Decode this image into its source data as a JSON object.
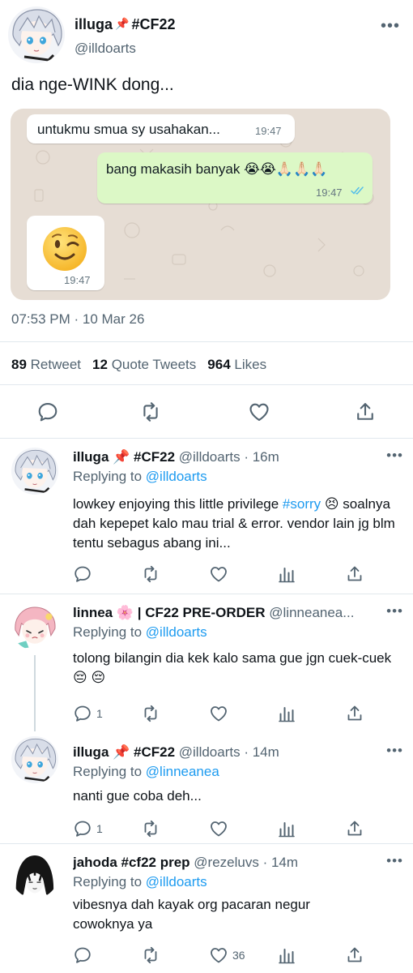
{
  "main_tweet": {
    "author": {
      "name": "illuga",
      "tag": "#CF22",
      "handle": "@illdoarts"
    },
    "text": "dia nge-WINK dong...",
    "chat": {
      "received_1": {
        "text": "untukmu smua sy usahakan...",
        "time": "19:47"
      },
      "sent_1": {
        "text": "bang makasih banyak 😭😭🙏🏻🙏🏻🙏🏻",
        "time": "19:47"
      },
      "received_2": {
        "emoji": "winking-face",
        "time": "19:47"
      }
    },
    "timestamp": "07:53 PM · 10 Mar 26",
    "stats": {
      "retweets": "89",
      "retweets_label": "Retweet",
      "quotes": "12",
      "quotes_label": "Quote Tweets",
      "likes": "964",
      "likes_label": "Likes"
    },
    "actions": [
      "reply-icon",
      "retweet-icon",
      "like-icon",
      "share-icon"
    ]
  },
  "replies": [
    {
      "name": "illuga 📌 #CF22",
      "meta": "@illdoarts · 16m",
      "replying_prefix": "Replying to",
      "replying_to": "@illdoarts",
      "body_before": "lowkey enjoying this little privilege ",
      "hashtag": "#sorry",
      "body_after": " 😣 soalnya dah kepepet kalo mau trial & error. vendor lain jg blm tentu sebagus abang ini...",
      "reply_count": "",
      "retweet_count": "",
      "like_count": ""
    },
    {
      "name": "linnea 🌸 | CF22 PRE-ORDER",
      "meta": "@linneanea...",
      "replying_prefix": "Replying to",
      "replying_to": "@illdoarts",
      "body": "tolong bilangin dia kek kalo sama gue jgn cuek-cuek 😔 😔",
      "reply_count": "1",
      "retweet_count": "",
      "like_count": ""
    },
    {
      "name": "illuga 📌 #CF22",
      "meta": "@illdoarts · 14m",
      "replying_prefix": "Replying to",
      "replying_to": "@linneanea",
      "body": "nanti gue coba deh...",
      "reply_count": "1",
      "retweet_count": "",
      "like_count": ""
    },
    {
      "name": "jahoda #cf22 prep",
      "meta": "@rezeluvs · 14m",
      "replying_prefix": "Replying to",
      "replying_to": "@illdoarts",
      "body": "vibesnya dah kayak org pacaran negur cowoknya ya",
      "reply_count": "",
      "retweet_count": "",
      "like_count": "36"
    }
  ],
  "colors": {
    "accent": "#1d9bf0",
    "secondary_text": "#536471",
    "chat_sent": "#dcf8c6",
    "chat_background": "#e6ddd4",
    "pin": "#e0245e"
  }
}
